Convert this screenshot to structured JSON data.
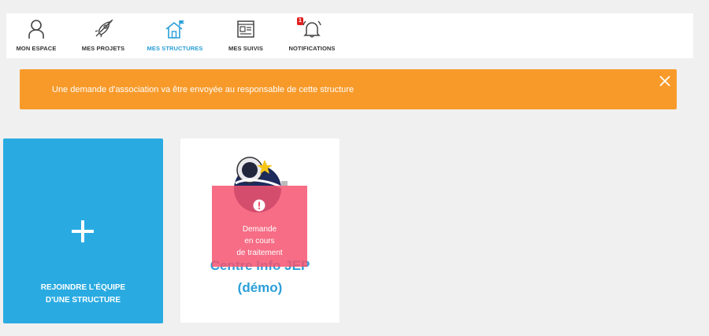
{
  "nav": {
    "items": [
      {
        "label": "MON ESPACE",
        "icon": "user-icon"
      },
      {
        "label": "MES PROJETS",
        "icon": "rocket-icon"
      },
      {
        "label": "MES STRUCTURES",
        "icon": "house-flag-icon",
        "active": true
      },
      {
        "label": "MES SUIVIS",
        "icon": "dashboard-icon"
      },
      {
        "label": "NOTIFICATIONS",
        "icon": "bell-icon",
        "badge": "1"
      }
    ]
  },
  "alert": {
    "message": "Une demande d'association va être envoyée au responsable de cette structure",
    "color": "#f89a2a"
  },
  "join_card": {
    "line1": "REJOINDRE L'ÉQUIPE",
    "line2": "D'UNE STRUCTURE",
    "color": "#29abe2"
  },
  "structure_card": {
    "name_line1": "Centre Info JEP",
    "name_line2": "(démo)",
    "pending_text": "Demande\nen cours\nde traitement",
    "pending_color": "#f45470"
  },
  "colors": {
    "active": "#2a9fd8"
  }
}
